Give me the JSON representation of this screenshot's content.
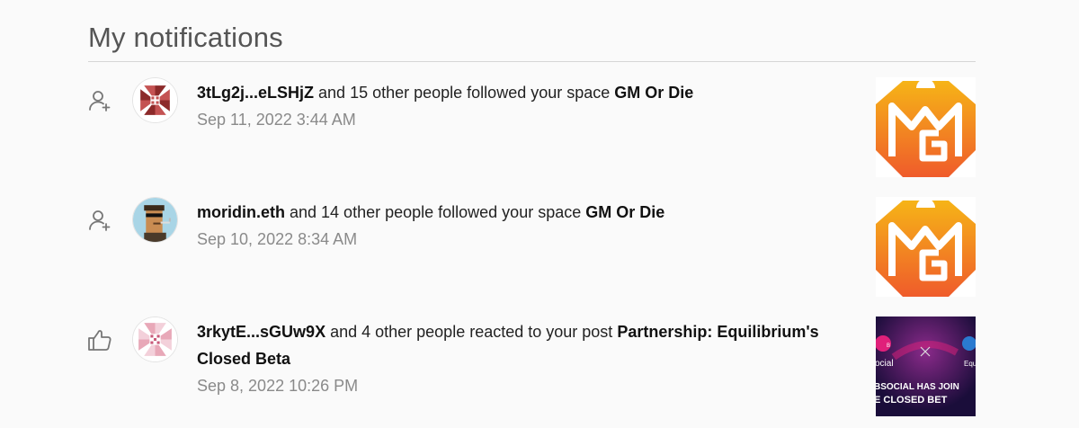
{
  "page": {
    "title": "My notifications"
  },
  "notifications": [
    {
      "type_icon": "user-plus-icon",
      "avatar_icon": "pinwheel-avatar-icon",
      "actor": "3tLg2j...eLSHjZ",
      "action": " and 15 other people followed your space ",
      "target": "GM Or Die",
      "date": "Sep 11, 2022 3:44 AM",
      "thumbnail": "gm-or-die-logo"
    },
    {
      "type_icon": "user-plus-icon",
      "avatar_icon": "pixel-character-avatar",
      "actor": "moridin.eth",
      "action": " and 14 other people followed your space ",
      "target": "GM Or Die",
      "date": "Sep 10, 2022 8:34 AM",
      "thumbnail": "gm-or-die-logo"
    },
    {
      "type_icon": "thumbs-up-icon",
      "avatar_icon": "pinwheel-avatar-icon",
      "actor": "3rkytE...sGUw9X",
      "action": " and 4 other people reacted to your post ",
      "target": "Partnership: Equilibrium's Closed Beta",
      "date": "Sep 8, 2022 10:26 PM",
      "thumbnail": "equilibrium-banner",
      "thumbnail_text": {
        "left": "ocial",
        "right": "Equili",
        "line1": "BSOCIAL HAS JOIN",
        "line2": "E CLOSED BET"
      }
    }
  ],
  "colors": {
    "logo_top": "#f6b417",
    "logo_bottom": "#ef5b2b",
    "banner_bg": "#1a0d3a",
    "banner_accent": "#e0207a"
  }
}
